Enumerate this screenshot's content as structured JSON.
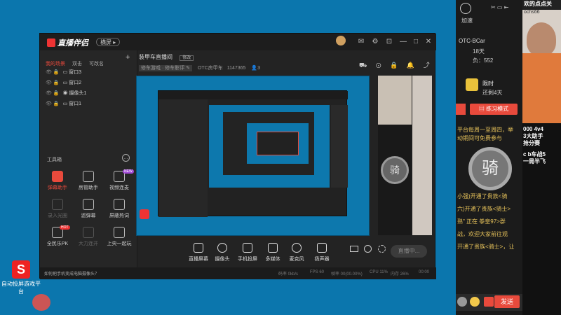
{
  "desktop": {
    "icon1_label": "自动投屏游戏平台",
    "icon1_glyph": "S"
  },
  "app": {
    "title": "直播伴侣",
    "mode_pill": "横屏 ▸",
    "window_buttons": [
      "⊡",
      "✉",
      "⚙",
      "—",
      "□",
      "✕"
    ],
    "tabs": [
      "我的场景",
      "双击",
      "可改名"
    ],
    "add": "+",
    "layers": [
      {
        "icon": "▭",
        "label": "窗口3"
      },
      {
        "icon": "▭",
        "label": "窗口2"
      },
      {
        "icon": "◉",
        "label": "摄像头1"
      },
      {
        "icon": "▭",
        "label": "窗口1"
      }
    ],
    "toolbox_label": "工具箱",
    "tools": [
      {
        "label": "弹幕助手"
      },
      {
        "label": "房管助手"
      },
      {
        "label": "视频连麦"
      },
      {
        "label": "录入光圈"
      },
      {
        "label": "滤弹幕"
      },
      {
        "label": "屏蔽热词"
      },
      {
        "label": "全民乐PK"
      },
      {
        "label": "大力连开"
      },
      {
        "label": "上央一起玩"
      }
    ],
    "tool_badges": {
      "video": "NEW",
      "pk": "HOT"
    },
    "room_title": "装甲车直播间",
    "room_edit": "修改",
    "room_tags": "修车游戏 · 修车影评 ✎",
    "room_id_label": "OTC房甲车",
    "room_id": "1147365",
    "room_fans": "3",
    "top_icons": [
      "⛟",
      "⊙",
      "🔒",
      "⎙",
      "🔔",
      "⤴"
    ],
    "bottom_buttons": [
      {
        "label": "直播屏幕"
      },
      {
        "label": "摄像头"
      },
      {
        "label": "手机投屏"
      },
      {
        "label": "多媒体"
      },
      {
        "label": "麦克风"
      },
      {
        "label": "扬声器"
      }
    ],
    "golive": "直播中...",
    "status_tip": "如何把手机变成电脑摄像头？",
    "status_items": [
      "码率 0kb/s",
      "FPS 60",
      "帧率 00(00.00%)",
      "CPU 11%",
      "内存 26%",
      "00:00"
    ]
  },
  "chat": {
    "header_id": "OTC-BCar",
    "level": "18天",
    "fans": "负：552",
    "limit": "限时",
    "remain": "还剩4天",
    "practice_btn": "练习模式",
    "feed": [
      "平台每周一至周四，举",
      "动期间可免费参与",
      "小强)开通了贵族<骑",
      "六)开通了贵族<骑士>",
      "熟\" 正在 拳皇97>群",
      "战，欢迎大家前往观",
      "开通了贵族<骑士>，让"
    ],
    "knight": "骑",
    "send": "发送",
    "speed": "加速"
  },
  "streamer": {
    "top_text": "欢的点点关",
    "user": "ochs66",
    "lines": [
      "000 4v4",
      "3大助手",
      "抢分赛",
      "c b车战5",
      "一局半飞"
    ]
  },
  "colors": {
    "accent": "#e84a3c",
    "desktop": "#0b76ad",
    "panel": "#232323"
  }
}
